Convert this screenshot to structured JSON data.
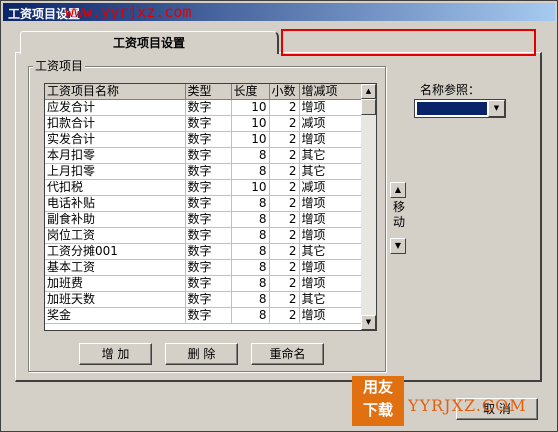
{
  "window": {
    "title": "工资项目设置"
  },
  "watermark_top": "www.yyrjxz.com",
  "tab": {
    "label": "工资项目设置"
  },
  "group": {
    "label": "工资项目"
  },
  "grid": {
    "headers": [
      "工资项目名称",
      "类型",
      "长度",
      "小数",
      "增减项"
    ],
    "rows": [
      [
        "应发合计",
        "数字",
        "10",
        "2",
        "增项"
      ],
      [
        "扣款合计",
        "数字",
        "10",
        "2",
        "减项"
      ],
      [
        "实发合计",
        "数字",
        "10",
        "2",
        "增项"
      ],
      [
        "本月扣零",
        "数字",
        "8",
        "2",
        "其它"
      ],
      [
        "上月扣零",
        "数字",
        "8",
        "2",
        "其它"
      ],
      [
        "代扣税",
        "数字",
        "10",
        "2",
        "减项"
      ],
      [
        "电话补贴",
        "数字",
        "8",
        "2",
        "增项"
      ],
      [
        "副食补助",
        "数字",
        "8",
        "2",
        "增项"
      ],
      [
        "岗位工资",
        "数字",
        "8",
        "2",
        "增项"
      ],
      [
        "工资分摊001",
        "数字",
        "8",
        "2",
        "其它"
      ],
      [
        "基本工资",
        "数字",
        "8",
        "2",
        "增项"
      ],
      [
        "加班费",
        "数字",
        "8",
        "2",
        "增项"
      ],
      [
        "加班天数",
        "数字",
        "8",
        "2",
        "其它"
      ],
      [
        "奖金",
        "数字",
        "8",
        "2",
        "增项"
      ]
    ]
  },
  "buttons": {
    "add": "增 加",
    "delete": "删 除",
    "rename": "重命名",
    "cancel": "取 消"
  },
  "move": {
    "label": "移动"
  },
  "name_ref": {
    "label": "名称参照：",
    "selected": ""
  },
  "logo": {
    "line1": "用友",
    "line2": "下载"
  },
  "watermark_bottom": "YYRJXZ.COM"
}
